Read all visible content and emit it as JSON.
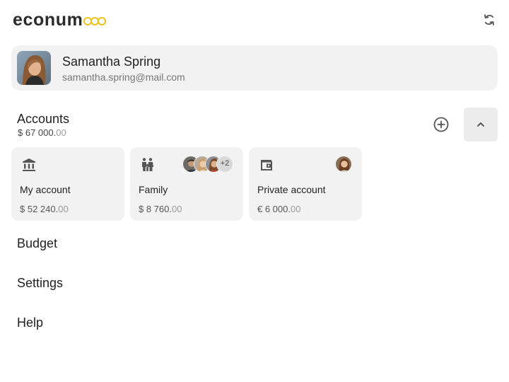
{
  "app": {
    "logo_text": "econum",
    "logo_color": "#f2c21b",
    "refresh_icon": "refresh-icon"
  },
  "profile": {
    "name": "Samantha Spring",
    "email": "samantha.spring@mail.com"
  },
  "accounts": {
    "title": "Accounts",
    "total_main": "$ 67 000.",
    "total_cents": "00",
    "add_icon": "add-circle-icon",
    "collapse_icon": "chevron-up-icon",
    "items": [
      {
        "name": "My account",
        "icon": "bank-icon",
        "amount_main": "$ 52 240.",
        "amount_cents": "00"
      },
      {
        "name": "Family",
        "icon": "family-icon",
        "amount_main": "$ 8 760.",
        "amount_cents": "00",
        "extra_members": "+2"
      },
      {
        "name": "Private account",
        "icon": "wallet-icon",
        "amount_main": "€ 6 000.",
        "amount_cents": "00"
      }
    ]
  },
  "menu": [
    {
      "label": "Budget"
    },
    {
      "label": "Settings"
    },
    {
      "label": "Help"
    }
  ]
}
